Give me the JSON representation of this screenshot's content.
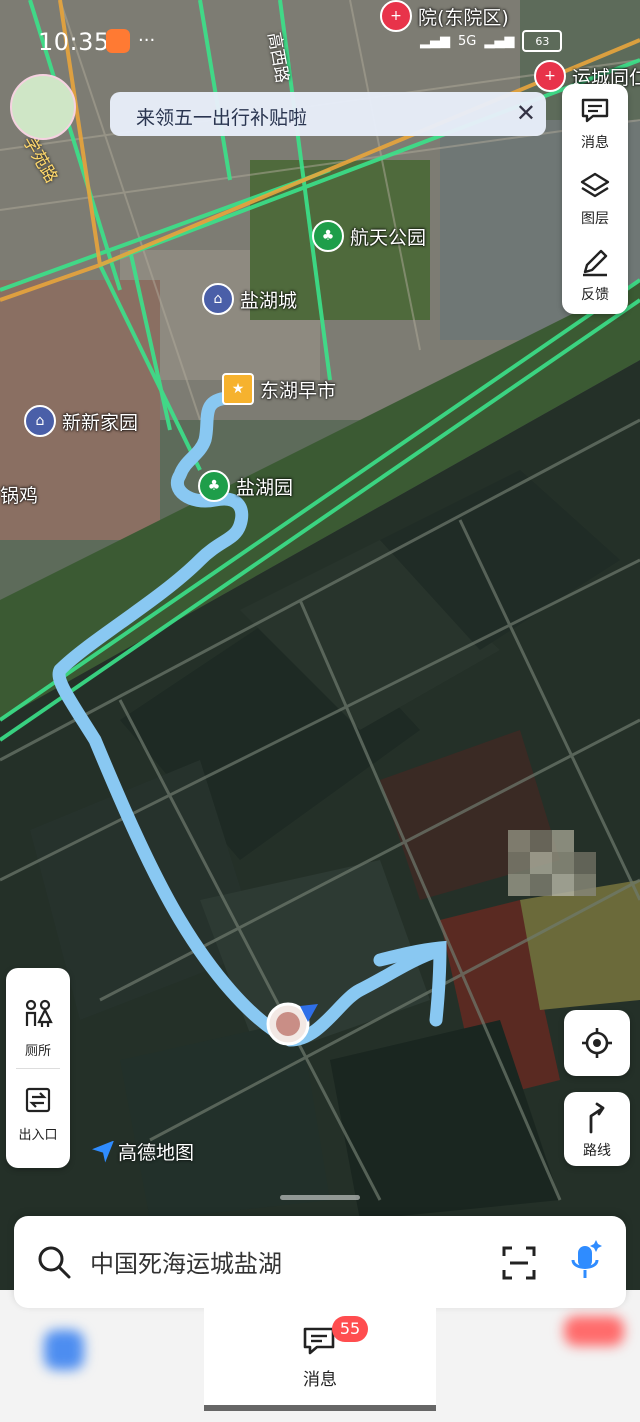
{
  "status_bar": {
    "time": "10:35",
    "network": "5G",
    "battery": "63"
  },
  "banner": {
    "text": "来领五一出行补贴啦",
    "close": "✕"
  },
  "tools": [
    {
      "label": "消息",
      "icon": "message-icon"
    },
    {
      "label": "图层",
      "icon": "layers-icon"
    },
    {
      "label": "反馈",
      "icon": "feedback-icon"
    }
  ],
  "map_labels": {
    "poi_hangtian": "航天公园",
    "poi_yanhucheng": "盐湖城",
    "poi_donghu": "东湖早市",
    "poi_xinxin": "新新家园",
    "poi_yanhuyuan": "盐湖园",
    "poi_guoji": "锅鸡",
    "road_gaoxi": "高西路",
    "road_xueyuan": "学苑路",
    "poi_hospital_top": "院(东院区)",
    "poi_hospital_right": "运城同仁"
  },
  "left_panel": {
    "toilet": "厕所",
    "entrance": "出入口"
  },
  "map_buttons": {
    "route": "路线"
  },
  "logo": {
    "text": "高德地图"
  },
  "search": {
    "text": "中国死海运城盐湖"
  },
  "bottom_nav": {
    "messages_label": "消息",
    "messages_badge": "55"
  },
  "colors": {
    "accent": "#2f8cff",
    "route_line": "#89c8f2",
    "road": "#3be28a",
    "badge": "#ff4d4f"
  }
}
